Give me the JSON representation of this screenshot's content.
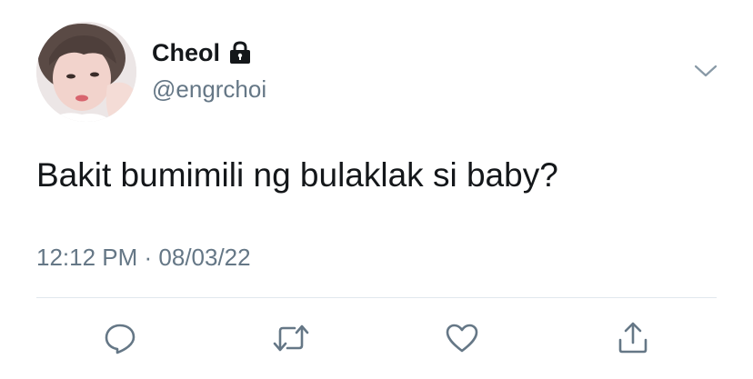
{
  "tweet": {
    "display_name": "Cheol",
    "handle": "@engrchoi",
    "text": "Bakit bumimili ng bulaklak si baby?",
    "timestamp": "12:12 PM · 08/03/22"
  },
  "icons": {
    "protected": "lock-icon",
    "menu": "chevron-down-icon",
    "reply": "reply-icon",
    "retweet": "retweet-icon",
    "like": "heart-icon",
    "share": "share-icon"
  },
  "colors": {
    "text": "#14171a",
    "secondary": "#657786",
    "divider": "#e1e8ed",
    "icon": "#657786"
  }
}
